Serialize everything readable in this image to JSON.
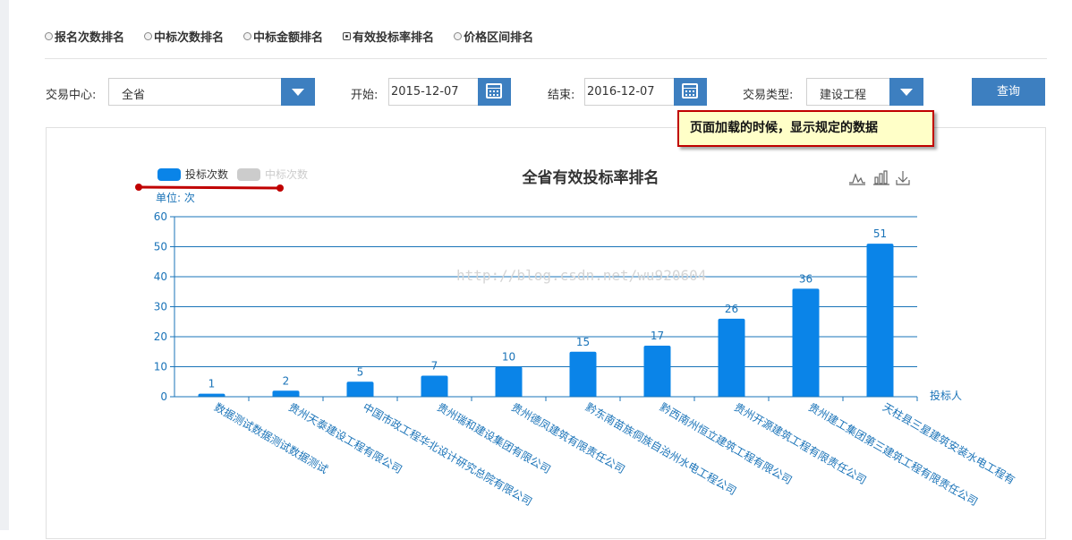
{
  "radios": [
    {
      "label": "报名次数排名",
      "checked": false
    },
    {
      "label": "中标次数排名",
      "checked": false
    },
    {
      "label": "中标金额排名",
      "checked": false
    },
    {
      "label": "有效投标率排名",
      "checked": true
    },
    {
      "label": "价格区间排名",
      "checked": false
    }
  ],
  "filters": {
    "center_label": "交易中心:",
    "center_value": "全省",
    "start_label": "开始:",
    "start_value": "2015-12-07",
    "end_label": "结束:",
    "end_value": "2016-12-07",
    "type_label": "交易类型:",
    "type_value": "建设工程",
    "query_label": "查询"
  },
  "tooltip": "页面加载的时候，显示规定的数据",
  "watermark": "http://blog.csdn.net/wu920604",
  "colors": {
    "accent": "#3d7fc0",
    "bar": "#0a84e8",
    "legend_off": "#cccccc",
    "axis": "#1a73b8",
    "annotation": "#c00000"
  },
  "toolbox_icons": [
    "line-chart-icon",
    "bar-chart-icon",
    "download-icon"
  ],
  "chart_data": {
    "type": "bar",
    "title": "全省有效投标率排名",
    "unit_label": "单位: 次",
    "xlabel": "投标人",
    "legend": [
      {
        "name": "投标次数",
        "active": true
      },
      {
        "name": "中标次数",
        "active": false
      }
    ],
    "legend_position": "top-left",
    "ylim": [
      0,
      60
    ],
    "yticks": [
      0,
      10,
      20,
      30,
      40,
      50,
      60
    ],
    "grid": true,
    "categories": [
      "数据测试数据测试数据测试",
      "贵州天泰建设工程有限公司",
      "中国市政工程华北设计研究总院有限公司",
      "贵州瑞和建设集团有限公司",
      "贵州德凤建筑有限责任公司",
      "黔东南苗族侗族自治州水电工程公司",
      "黔西南州恒立建筑工程有限公司",
      "贵州开源建筑工程有限责任公司",
      "贵州建工集团第三建筑工程有限责任公司",
      "天柱县三星建筑安装水电工程有"
    ],
    "series": [
      {
        "name": "投标次数",
        "values": [
          1,
          2,
          5,
          7,
          10,
          15,
          17,
          26,
          36,
          51
        ]
      }
    ]
  }
}
